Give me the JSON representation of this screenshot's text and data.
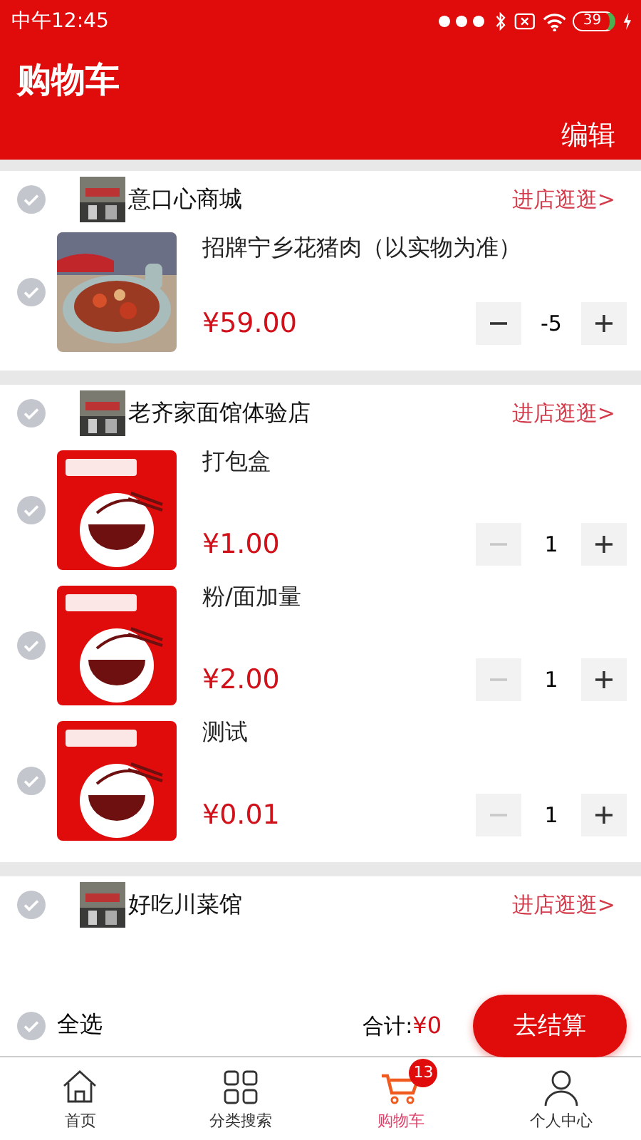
{
  "status_bar": {
    "time": "中午12:45",
    "battery": "39"
  },
  "header": {
    "title": "购物车",
    "edit": "编辑"
  },
  "stores": [
    {
      "name": "意口心商城",
      "link": "进店逛逛>",
      "checked": false,
      "items": [
        {
          "name": "招牌宁乡花猪肉（以实物为准）",
          "price": "¥59.00",
          "quantity": "-5",
          "checked": false,
          "minus_disabled": false
        }
      ]
    },
    {
      "name": "老齐家面馆体验店",
      "link": "进店逛逛>",
      "checked": false,
      "items": [
        {
          "name": "打包盒",
          "price": "¥1.00",
          "quantity": "1",
          "checked": false,
          "minus_disabled": true
        },
        {
          "name": "粉/面加量",
          "price": "¥2.00",
          "quantity": "1",
          "checked": false,
          "minus_disabled": true
        },
        {
          "name": "测试",
          "price": "¥0.01",
          "quantity": "1",
          "checked": false,
          "minus_disabled": true
        }
      ]
    },
    {
      "name": "好吃川菜馆",
      "link": "进店逛逛>",
      "checked": false
    }
  ],
  "footer": {
    "select_all": "全选",
    "select_all_checked": false,
    "total_label": "合计:",
    "total": "¥0",
    "checkout": "去结算"
  },
  "tabs": [
    {
      "label": "首页",
      "selected": false
    },
    {
      "label": "分类搜索",
      "selected": false
    },
    {
      "label": "购物车",
      "selected": true,
      "badge": "13"
    },
    {
      "label": "个人中心",
      "selected": false
    }
  ]
}
